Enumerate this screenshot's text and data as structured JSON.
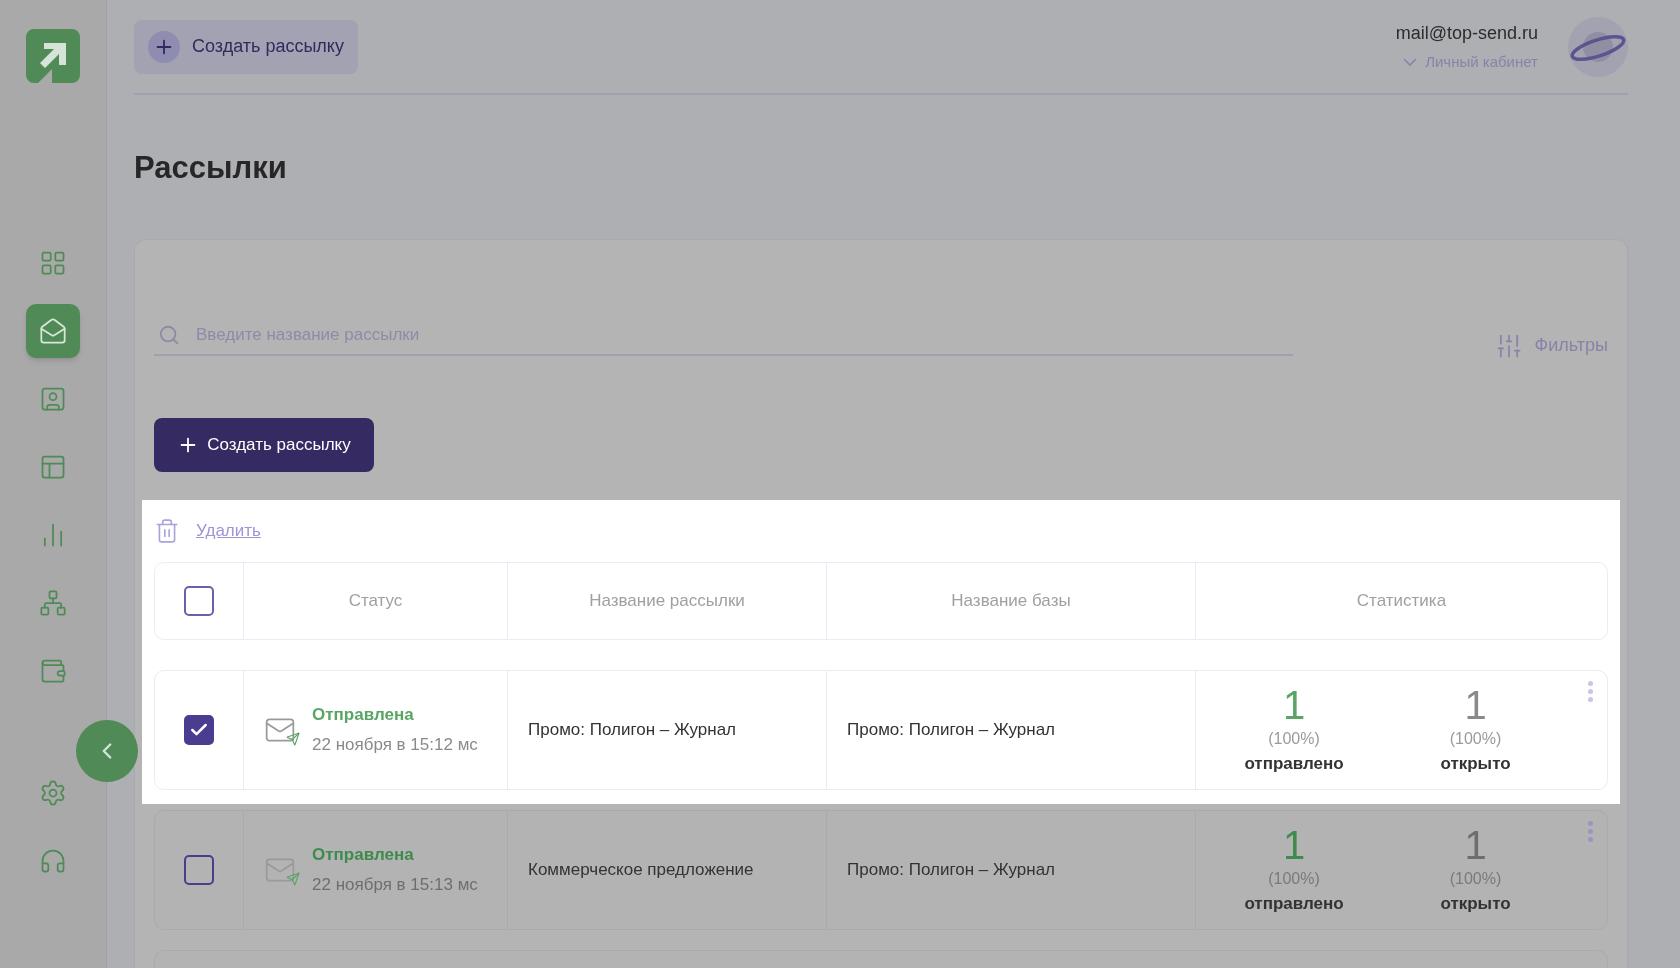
{
  "header": {
    "create_button": "Создать рассылку",
    "email": "mail@top-send.ru",
    "account_link": "Личный кабинет"
  },
  "sidebar": {
    "items": [
      {
        "kind": "grid",
        "selected": false
      },
      {
        "kind": "mail",
        "selected": true
      },
      {
        "kind": "contacts",
        "selected": false
      },
      {
        "kind": "templates",
        "selected": false
      },
      {
        "kind": "chart",
        "selected": false
      },
      {
        "kind": "network",
        "selected": false
      },
      {
        "kind": "wallet",
        "selected": false
      },
      {
        "kind": "settings",
        "selected": false
      },
      {
        "kind": "support",
        "selected": false
      }
    ]
  },
  "page": {
    "title": "Рассылки",
    "search": {
      "placeholder": "Введите название рассылки"
    },
    "filters": "Фильтры",
    "create_button": "Создать рассылку",
    "delete_link": "Удалить"
  },
  "table": {
    "all_checked": false,
    "columns": [
      "Статус",
      "Название рассылки",
      "Название базы",
      "Статистика"
    ],
    "rows": [
      {
        "kind": "full",
        "highlighted": true,
        "checked": true,
        "status": "Отправлена",
        "date": "22 ноября в 15:12 мс",
        "name": "Промо: Полигон – Журнал",
        "base": "Промо: Полигон – Журнал",
        "sent": "1",
        "sent_pct": "(100%)",
        "sent_label": "отправлено",
        "opened": "1",
        "opened_pct": "(100%)",
        "opened_label": "открыто"
      },
      {
        "kind": "full",
        "highlighted": false,
        "checked": false,
        "status": "Отправлена",
        "date": "22 ноября в 15:13 мс",
        "name": "Коммерческое предложение",
        "base": "Промо: Полигон – Журнал",
        "sent": "1",
        "sent_pct": "(100%)",
        "sent_label": "отправлено",
        "opened": "1",
        "opened_pct": "(100%)",
        "opened_label": "открыто"
      },
      {
        "kind": "partial",
        "highlighted": false
      }
    ]
  }
}
